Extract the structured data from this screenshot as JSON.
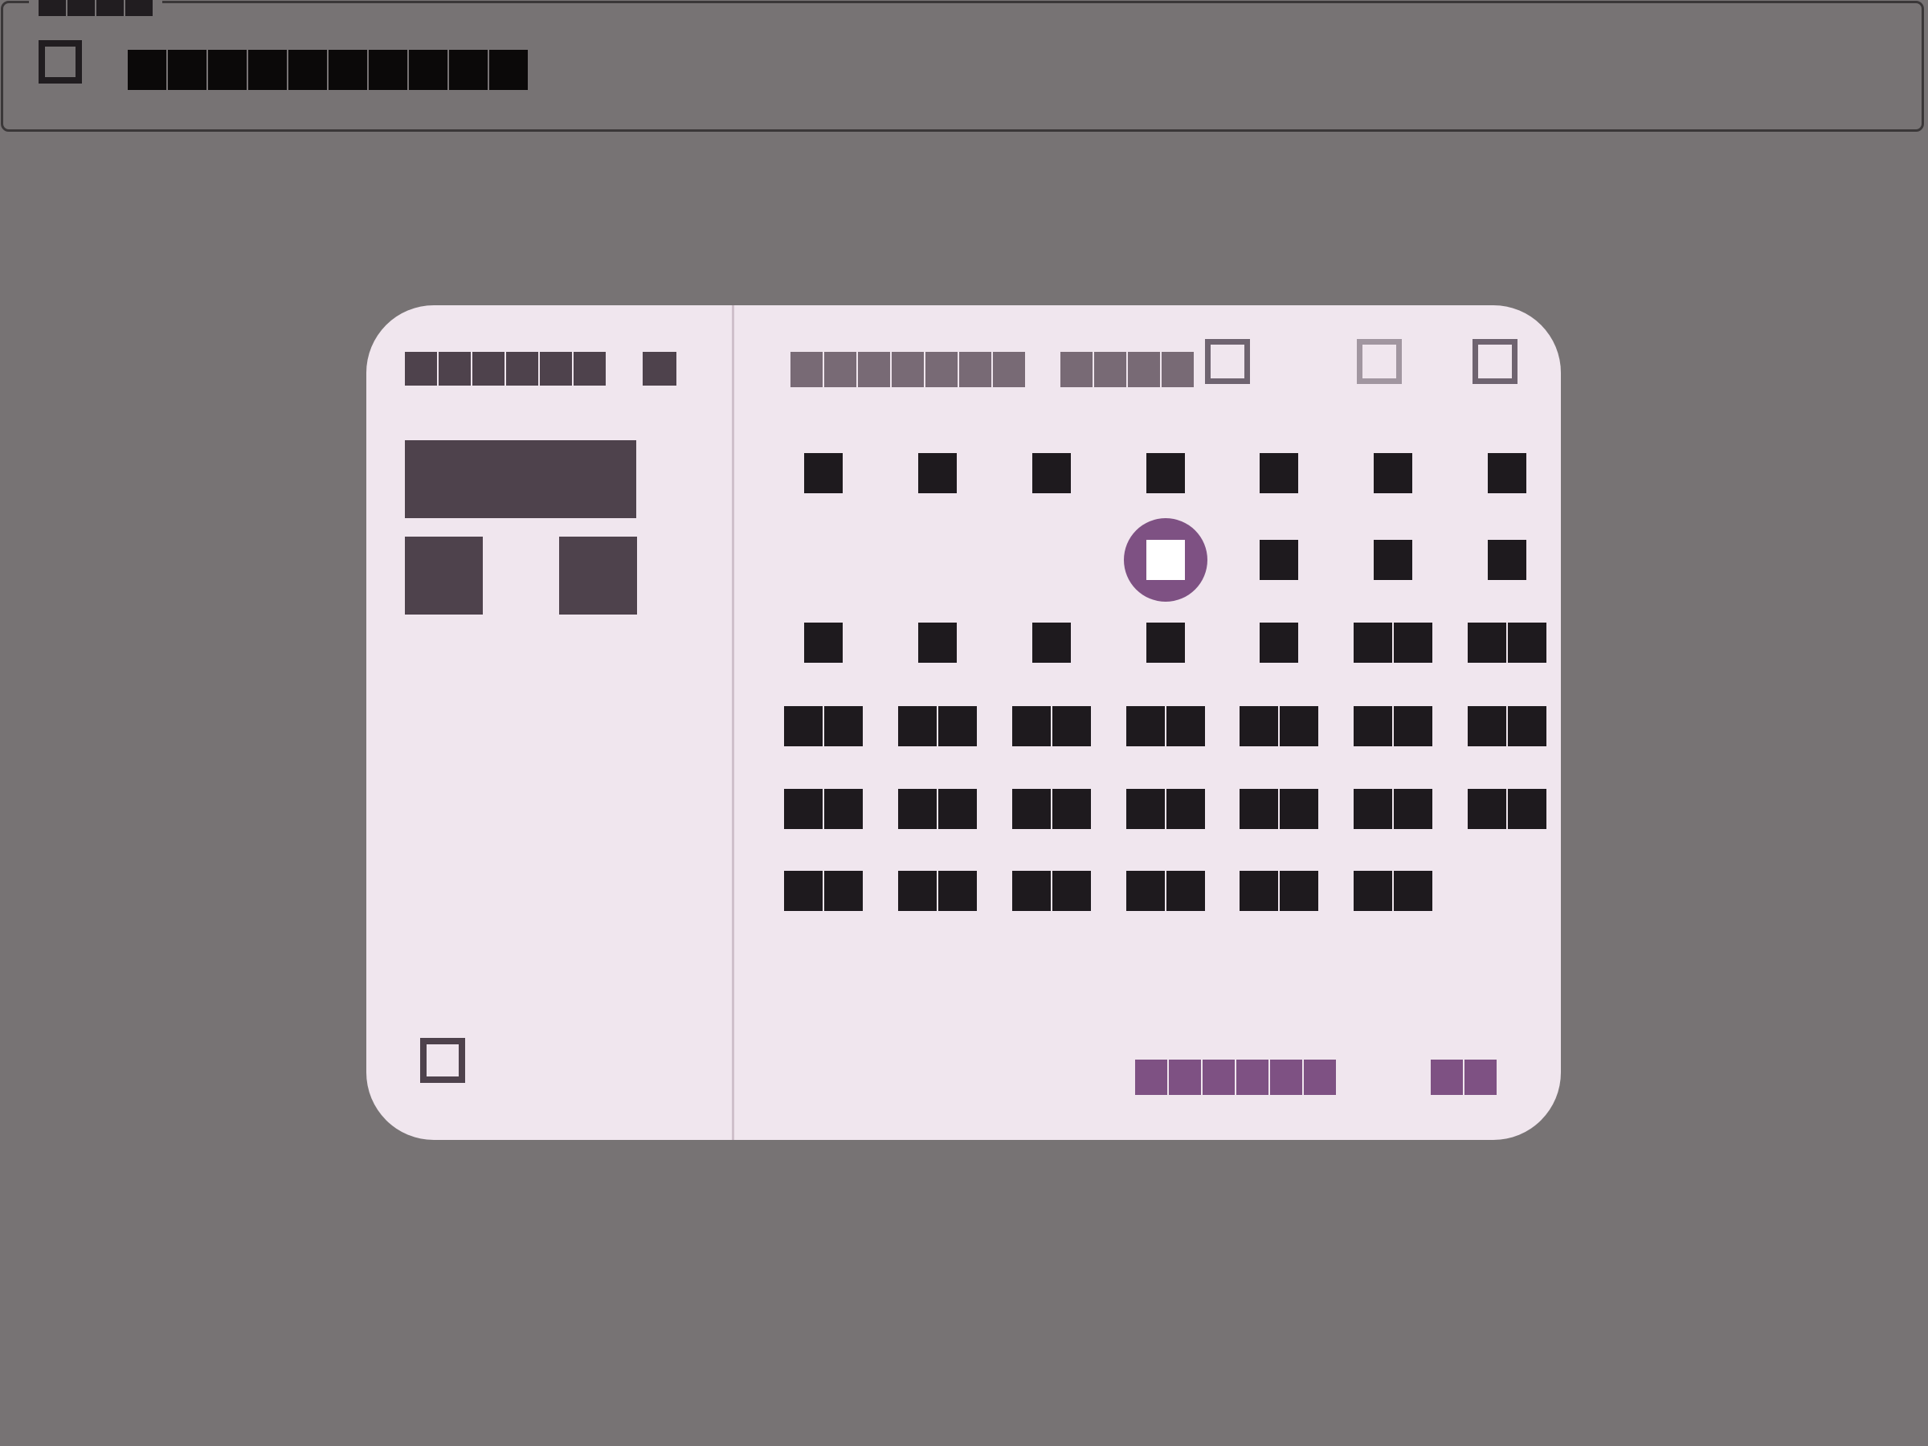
{
  "top_field": {
    "legend": "▯▯▯▯",
    "value": "▯▯▯▯▯▯▯▯▯▯"
  },
  "dialog": {
    "header_label": "▯▯▯▯▯▯",
    "header_dot": "▯",
    "month_label": "▯▯▯▯▯▯▯",
    "year_label": "▯▯▯▯",
    "weekdays": [
      "▯",
      "▯",
      "▯",
      "▯",
      "▯",
      "▯",
      "▯"
    ],
    "days": [
      [
        "",
        "",
        "",
        "▯",
        "▯",
        "▯",
        "▯"
      ],
      [
        "▯",
        "▯",
        "▯",
        "▯",
        "▯",
        "▯▯",
        "▯▯"
      ],
      [
        "▯▯",
        "▯▯",
        "▯▯",
        "▯▯",
        "▯▯",
        "▯▯",
        "▯▯"
      ],
      [
        "▯▯",
        "▯▯",
        "▯▯",
        "▯▯",
        "▯▯",
        "▯▯",
        "▯▯"
      ],
      [
        "▯▯",
        "▯▯",
        "▯▯",
        "▯▯",
        "▯▯",
        "▯▯",
        ""
      ]
    ],
    "selected_day": "▯",
    "cancel_label": "▯▯▯▯▯▯",
    "ok_label": "▯▯"
  },
  "colors": {
    "accent": "#7e5183",
    "surface": "#f0e6ee",
    "backdrop": "#777374",
    "header_tint": "#4e424c"
  },
  "icons": {
    "top_field_icon": "calendar-icon",
    "edit_icon": "edit-pencil-icon",
    "prev_icon": "chevron-left-icon",
    "next_icon": "chevron-right-icon",
    "year_dropdown_icon": "dropdown-arrow-icon"
  }
}
